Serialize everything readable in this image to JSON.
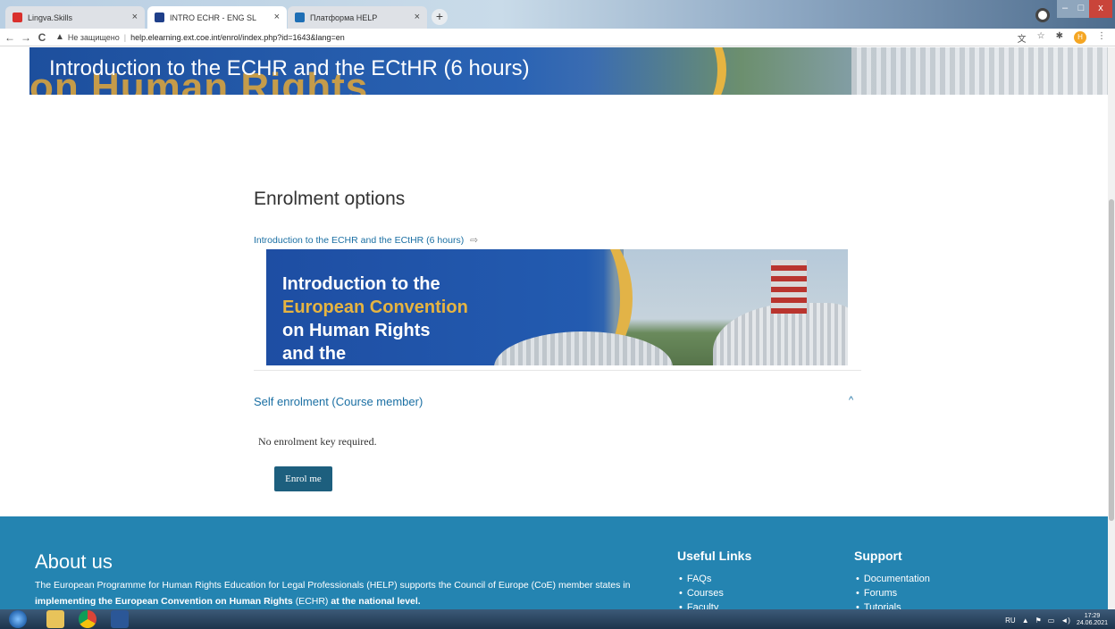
{
  "browser": {
    "tabs": [
      {
        "title": "Lingva.Skills",
        "active": false
      },
      {
        "title": "INTRO ECHR - ENG SL",
        "active": true
      },
      {
        "title": "Платформа HELP",
        "active": false
      }
    ],
    "new_tab": "+",
    "close_glyph": "×",
    "nav": {
      "back": "←",
      "forward": "→",
      "reload": "C"
    },
    "security_label": "Не защищено",
    "url": "help.elearning.ext.coe.int/enrol/index.php?id=1643&lang=en",
    "profile_initial": "H",
    "colors": {
      "accent_footer": "#2484b1",
      "button": "#1d5f7e",
      "link": "#1a6fa3"
    }
  },
  "hero": {
    "ghost_text": "on Human Rights",
    "title": "Introduction to the ECHR and the ECtHR (6 hours)"
  },
  "enrolment": {
    "heading": "Enrolment options",
    "course_link": "Introduction to the ECHR and the ECtHR (6 hours)",
    "course_link_icon": "enter-icon",
    "image_lines": [
      "Introduction to the",
      "European Convention",
      "on Human Rights",
      "and the"
    ],
    "self_enrol_title": "Self enrolment (Course member)",
    "collapse_icon": "chevron-up-icon",
    "no_key_text": "No enrolment key required.",
    "enrol_button": "Enrol me"
  },
  "footer": {
    "about_heading": "About us",
    "about_text_1": "The European Programme for Human Rights Education for Legal Professionals (HELP) supports the Council of Europe (CoE) member states in",
    "about_bold_1": "implementing the European Convention on Human Rights",
    "about_text_2": "(ECHR)",
    "about_bold_2": "at the national level.",
    "useful_links_heading": "Useful Links",
    "useful_links": [
      "FAQs",
      "Courses",
      "Faculty"
    ],
    "support_heading": "Support",
    "support_links": [
      "Documentation",
      "Forums",
      "Tutorials"
    ]
  },
  "taskbar": {
    "lang": "RU",
    "time": "17:29",
    "date": "24.06.2021"
  }
}
